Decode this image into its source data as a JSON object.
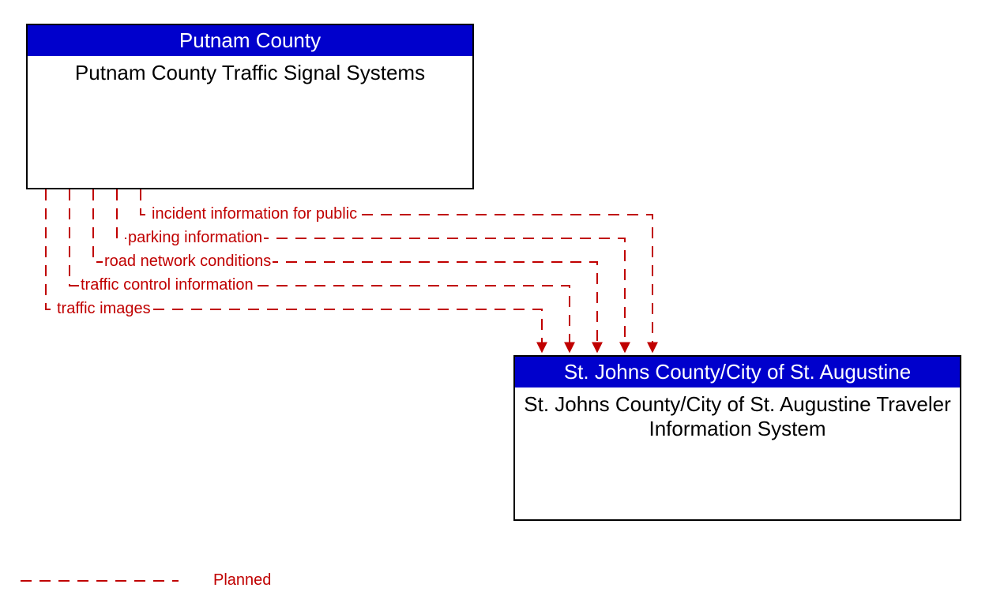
{
  "entities": {
    "source": {
      "header": "Putnam County",
      "body": "Putnam County Traffic Signal Systems"
    },
    "target": {
      "header": "St. Johns County/City of St. Augustine",
      "body": "St. Johns County/City of St. Augustine Traveler Information System"
    }
  },
  "flows": [
    "incident information for public",
    "parking information",
    "road network conditions",
    "traffic control information",
    "traffic images"
  ],
  "legend": {
    "planned": "Planned"
  },
  "colors": {
    "header_bg": "#0000cc",
    "header_fg": "#ffffff",
    "entity_border": "#000000",
    "flow": "#c00000"
  }
}
